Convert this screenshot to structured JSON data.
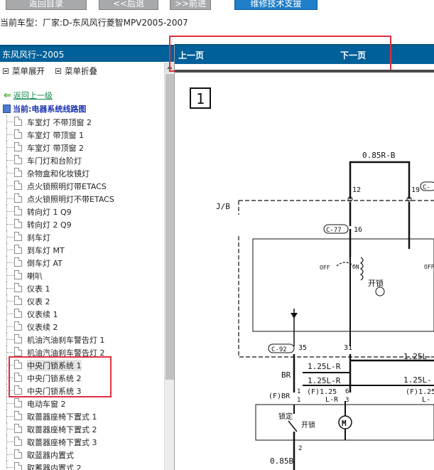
{
  "toolbar": {
    "back_to_catalog": "返回目录",
    "back": "<<后退",
    "forward": ">>前进",
    "tech_support": "维修技术支援"
  },
  "model_line": "当前车型：厂家:D-东风风行菱智MPV2005-2007",
  "left_panel": {
    "title": "东风风行--2005",
    "menu_expand": "菜单展开",
    "menu_collapse": "菜单折叠",
    "back_link": "返回上一级",
    "current": "当前:电器系统线路图",
    "items": [
      {
        "label": "车室灯 不带顶窗 2"
      },
      {
        "label": "车室灯 带顶窗 1"
      },
      {
        "label": "车室灯 带顶窗 2"
      },
      {
        "label": "车门灯和台阶灯"
      },
      {
        "label": "杂物盒和化妆镜灯"
      },
      {
        "label": "点火锁照明灯带ETACS"
      },
      {
        "label": "点火锁照明灯不带ETACS"
      },
      {
        "label": "转向灯 1 Q9"
      },
      {
        "label": "转向灯 2 Q9"
      },
      {
        "label": "刹车灯"
      },
      {
        "label": "到车灯 MT"
      },
      {
        "label": "倒车灯 AT"
      },
      {
        "label": "喇叭"
      },
      {
        "label": "仪表 1"
      },
      {
        "label": "仪表 2"
      },
      {
        "label": "仪表续 1"
      },
      {
        "label": "仪表续 2"
      },
      {
        "label": "机油汽油刹车警告灯 1"
      },
      {
        "label": "机油汽油刹车警告灯 2"
      },
      {
        "label": "中央门锁系统 1"
      },
      {
        "label": "中央门锁系统 2"
      },
      {
        "label": "中央门锁系统 3"
      },
      {
        "label": "电动车窗 2"
      },
      {
        "label": "取蔷器座椅下置式 1"
      },
      {
        "label": "取蔷器座椅下置式 2"
      },
      {
        "label": "取蔷器座椅下置式 3"
      },
      {
        "label": "取蓝器内置式"
      },
      {
        "label": "取蓄器内置式 2"
      }
    ]
  },
  "right_panel": {
    "prev_page": "上一页",
    "next_page": "下一页"
  },
  "diagram": {
    "page_number": "1",
    "labels": {
      "wire_top": "0.85R-B",
      "pin_12": "12",
      "pin_19": "19",
      "conn_c": "C-",
      "jb": "J/B",
      "conn_c77": "C-77",
      "pin_16": "16",
      "off1": "OFF",
      "on": "ON",
      "off2": "OFF",
      "kaisuo1": "开锁",
      "conn_c92": "C-92",
      "pin_35": "35",
      "pin_31": "31",
      "wire_125l_right": "1.25L-",
      "br1": "BR",
      "wire_125lr_1": "1.25L-R",
      "wire_125lr_2": "1.25L-R",
      "wire_125l_right2": "1.25L-",
      "fbr": "(F)BR",
      "pin_1a": "1",
      "pin_1b": "1",
      "f125": "(F)1.25",
      "lr": "L-R",
      "pin_6": "6",
      "pin_3": "3",
      "f125_right": "(F)1.25",
      "l_right": "L-",
      "suoding": "锁定",
      "kaisuo2": "开锁",
      "pin_2": "2",
      "wire_085b": "0.85B"
    }
  }
}
